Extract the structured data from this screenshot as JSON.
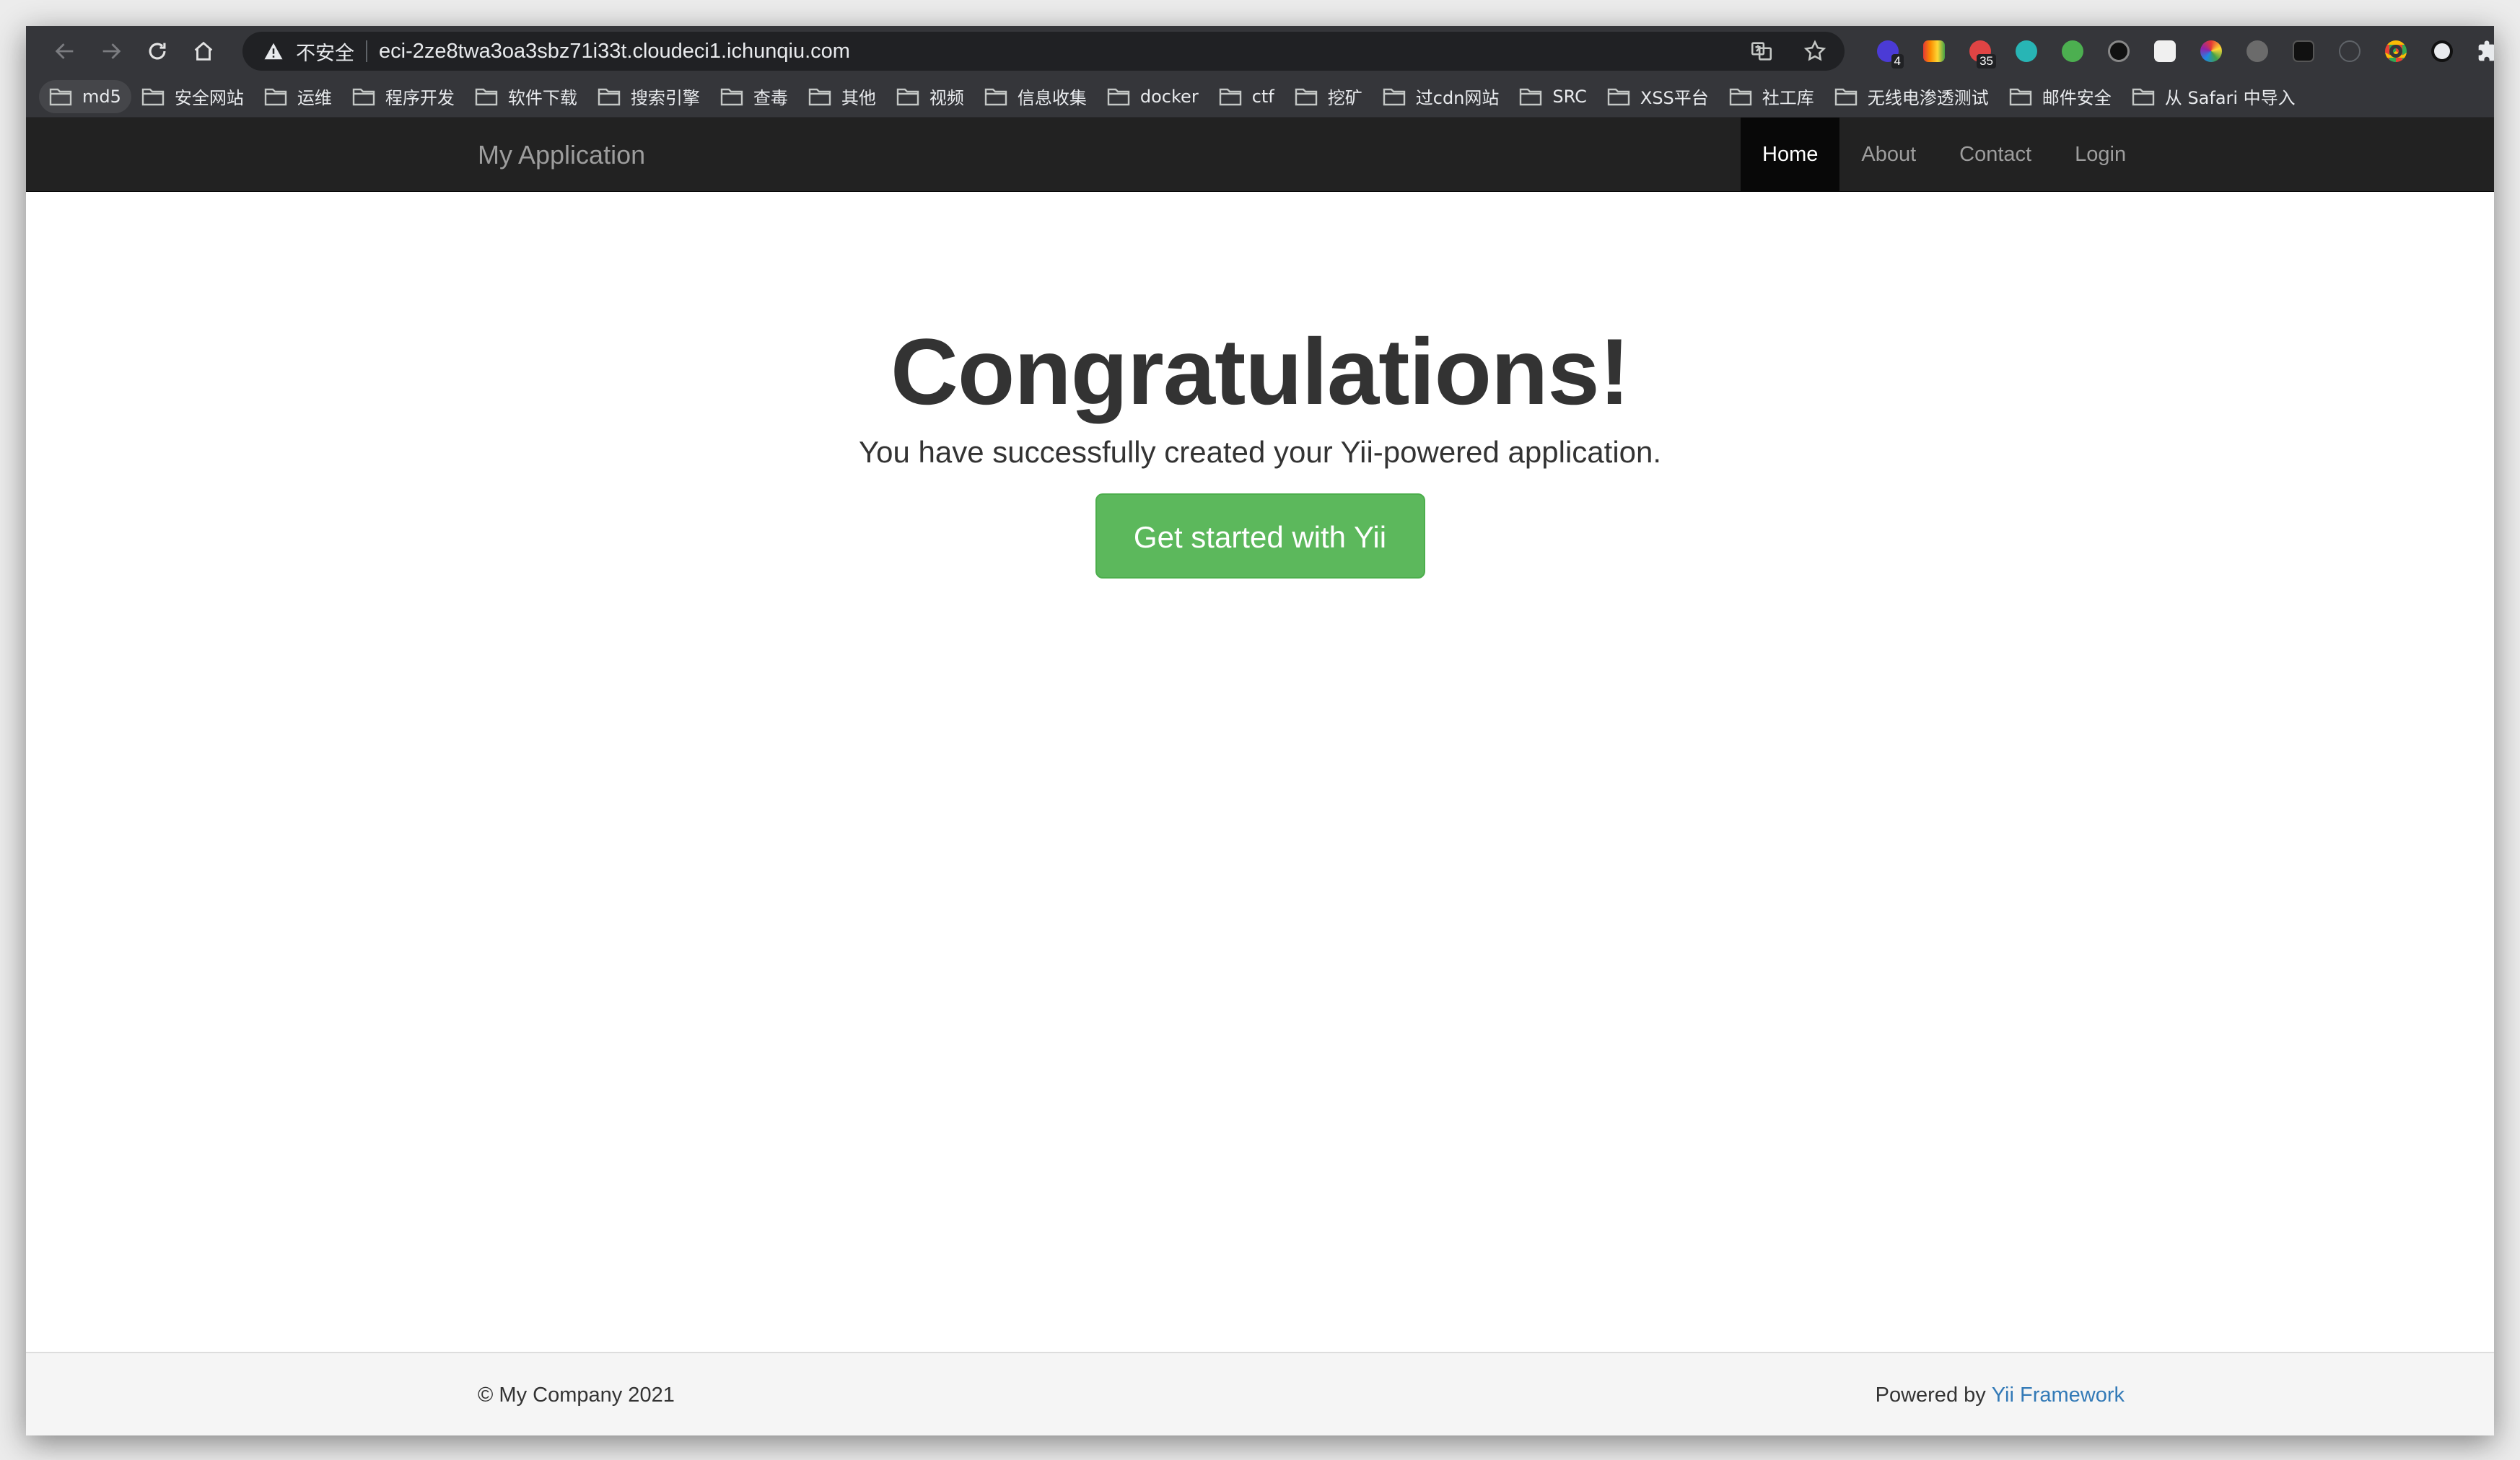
{
  "browser": {
    "security_label": "不安全",
    "url": "eci-2ze8twa3oa3sbz71i33t.cloudeci1.ichunqiu.com",
    "extensions": [
      {
        "icon": "puzzle-purple-icon",
        "color": "#4b3bd6",
        "badge": "4"
      },
      {
        "icon": "rainbow-square-icon",
        "color": "#e85d2c",
        "badge": ""
      },
      {
        "icon": "red-panda-icon",
        "color": "#e04444",
        "badge": "35"
      },
      {
        "icon": "m-circle-icon",
        "color": "#28b5b5",
        "badge": ""
      },
      {
        "icon": "green-face-icon",
        "color": "#4caf50",
        "badge": ""
      },
      {
        "icon": "black-circle-icon",
        "color": "#111111",
        "badge": ""
      },
      {
        "icon": "stack-icon",
        "color": "#f0f0f0",
        "badge": ""
      },
      {
        "icon": "color-wheel-icon",
        "color": "#e7a21c",
        "badge": ""
      },
      {
        "icon": "gear-gray-icon",
        "color": "#7a7a7a",
        "badge": ""
      },
      {
        "icon": "dark-square-icon",
        "color": "#1a1a1a",
        "badge": ""
      },
      {
        "icon": "info-gray-icon",
        "color": "#5f6368",
        "badge": ""
      },
      {
        "icon": "chrome-ring-icon",
        "color": "#e94235",
        "badge": ""
      },
      {
        "icon": "panda-icon",
        "color": "#e8eaed",
        "badge": ""
      },
      {
        "icon": "extensions-puzzle-icon",
        "color": "#e8eaed",
        "badge": ""
      }
    ]
  },
  "bookmarks": [
    "md5",
    "安全网站",
    "运维",
    "程序开发",
    "软件下载",
    "搜索引擎",
    "查毒",
    "其他",
    "视频",
    "信息收集",
    "docker",
    "ctf",
    "挖矿",
    "过cdn网站",
    "SRC",
    "XSS平台",
    "社工库",
    "无线电渗透测试",
    "邮件安全",
    "从 Safari 中导入"
  ],
  "app": {
    "brand": "My Application",
    "nav": [
      "Home",
      "About",
      "Contact",
      "Login"
    ],
    "active_nav": "Home",
    "heading": "Congratulations!",
    "lead": "You have successfully created your Yii-powered application.",
    "cta": "Get started with Yii",
    "footer_left": "© My Company 2021",
    "footer_powered": "Powered by",
    "footer_link": "Yii Framework"
  }
}
